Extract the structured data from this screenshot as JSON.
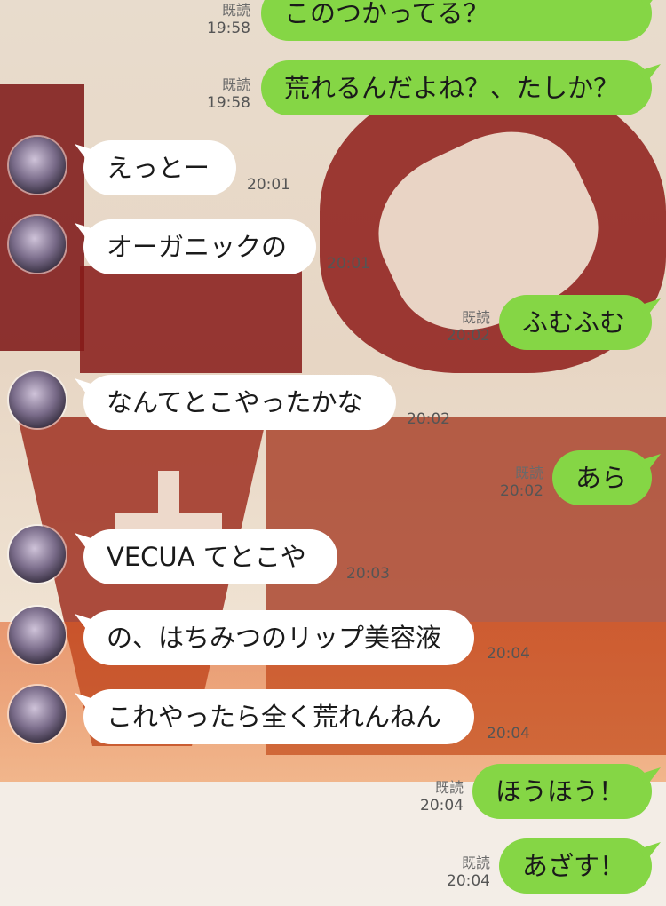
{
  "read_label": "既読",
  "messages": [
    {
      "side": "out",
      "text": "このつかってる？",
      "time": "19:58",
      "read": "既読"
    },
    {
      "side": "out",
      "text": "荒れるんだよね？、たしか？",
      "time": "19:58",
      "read": "既読"
    },
    {
      "side": "in",
      "text": "えっとー",
      "time": "20:01"
    },
    {
      "side": "in",
      "text": "オーガニックの",
      "time": "20:01"
    },
    {
      "side": "out",
      "text": "ふむふむ",
      "time": "20:02",
      "read": "既読"
    },
    {
      "side": "in",
      "text": "なんてとこやったかな",
      "time": "20:02"
    },
    {
      "side": "out",
      "text": "あら",
      "time": "20:02",
      "read": "既読"
    },
    {
      "side": "in",
      "text": "VECUA てとこや",
      "time": "20:03"
    },
    {
      "side": "in",
      "text": "の、はちみつのリップ美容液",
      "time": "20:04"
    },
    {
      "side": "in",
      "text": "これやったら全く荒れんねん",
      "time": "20:04"
    },
    {
      "side": "out",
      "text": "ほうほう！",
      "time": "20:04",
      "read": "既読"
    },
    {
      "side": "out",
      "text": "あざす！",
      "time": "20:04",
      "read": "既読"
    }
  ]
}
